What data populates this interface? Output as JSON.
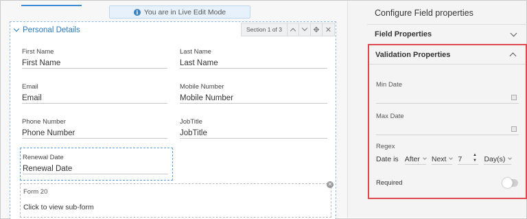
{
  "banner": {
    "text": "You are in Live Edit Mode",
    "icon": "info-icon"
  },
  "section": {
    "title": "Personal Details",
    "counter": "Section 1 of 3",
    "tools": [
      "chevron-up-icon",
      "chevron-down-icon",
      "move-icon",
      "close-icon"
    ]
  },
  "fields": {
    "first_name": {
      "label": "First Name",
      "placeholder": "First Name"
    },
    "last_name": {
      "label": "Last Name",
      "placeholder": "Last Name"
    },
    "email": {
      "label": "Email",
      "placeholder": "Email"
    },
    "mobile": {
      "label": "Mobile Number",
      "placeholder": "Mobile Number"
    },
    "phone": {
      "label": "Phone Number",
      "placeholder": "Phone Number"
    },
    "jobtitle": {
      "label": "JobTitle",
      "placeholder": "JobTitle"
    },
    "renewal": {
      "label": "Renewal Date",
      "placeholder": "Renewal Date"
    }
  },
  "subform": {
    "title": "Form 20",
    "link": "Click to view sub-form"
  },
  "panel": {
    "title": "Configure Field properties",
    "field_properties": "Field Properties",
    "validation": {
      "title": "Validation Properties",
      "min_date": "Min Date",
      "max_date": "Max Date",
      "regex": "Regex",
      "date_is": "Date is",
      "relation": "After",
      "period": "Next",
      "count": "7",
      "unit": "Day(s)",
      "required": "Required",
      "required_on": false
    }
  },
  "colors": {
    "accent": "#2a7bc0",
    "highlight_border": "#e0474c"
  }
}
